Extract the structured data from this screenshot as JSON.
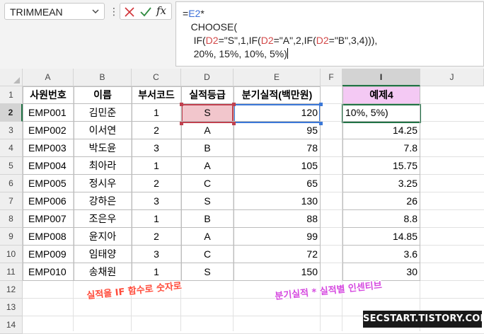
{
  "name_box": {
    "value": "TRIMMEAN"
  },
  "toolbar": {
    "dots": "⋮",
    "cancel_icon": "x-icon",
    "enter_icon": "checkmark-icon",
    "fx_label": "fx"
  },
  "formula": {
    "l1a": "=",
    "l1b": "E2",
    "l1c": "*",
    "l2": "CHOOSE(",
    "l3a": "IF(",
    "l3b": "D2",
    "l3c": "=\"S\",1,IF(",
    "l3d": "D2",
    "l3e": "=\"A\",2,IF(",
    "l3f": "D2",
    "l3g": "=\"B\",3,4))),",
    "l4": "20%, 15%, 10%, 5%)"
  },
  "columns": [
    "A",
    "B",
    "C",
    "D",
    "E",
    "F",
    "I",
    "J"
  ],
  "rows": [
    "1",
    "2",
    "3",
    "4",
    "5",
    "6",
    "7",
    "8",
    "9",
    "10",
    "11",
    "12",
    "13",
    "14"
  ],
  "table": {
    "headers": [
      "사원번호",
      "이름",
      "부서코드",
      "실적등급",
      "분기실적(백만원)"
    ],
    "rows": [
      [
        "EMP001",
        "김민준",
        "1",
        "S",
        "120"
      ],
      [
        "EMP002",
        "이서연",
        "2",
        "A",
        "95"
      ],
      [
        "EMP003",
        "박도윤",
        "3",
        "B",
        "78"
      ],
      [
        "EMP004",
        "최아라",
        "1",
        "A",
        "105"
      ],
      [
        "EMP005",
        "정시우",
        "2",
        "C",
        "65"
      ],
      [
        "EMP006",
        "강하은",
        "3",
        "S",
        "130"
      ],
      [
        "EMP007",
        "조은우",
        "1",
        "B",
        "88"
      ],
      [
        "EMP008",
        "윤지아",
        "2",
        "A",
        "99"
      ],
      [
        "EMP009",
        "임태양",
        "3",
        "C",
        "72"
      ],
      [
        "EMP010",
        "송채원",
        "1",
        "S",
        "150"
      ]
    ]
  },
  "example": {
    "header": "예제4",
    "editing": "10%, 5%)",
    "values": [
      "14.25",
      "7.8",
      "15.75",
      "3.25",
      "26",
      "8.8",
      "14.85",
      "3.6",
      "30"
    ]
  },
  "annotations": {
    "note1": "실적을 IF 함수로 숫자로",
    "note2": "분기실적 * 실적별 인센티브",
    "watermark": "SECSTART.TISTORY.COM"
  },
  "colors": {
    "accent_green": "#217346",
    "ref_blue": "#3b78d8",
    "ref_red": "#c0414f",
    "example_header_bg": "#f4c9f4"
  }
}
